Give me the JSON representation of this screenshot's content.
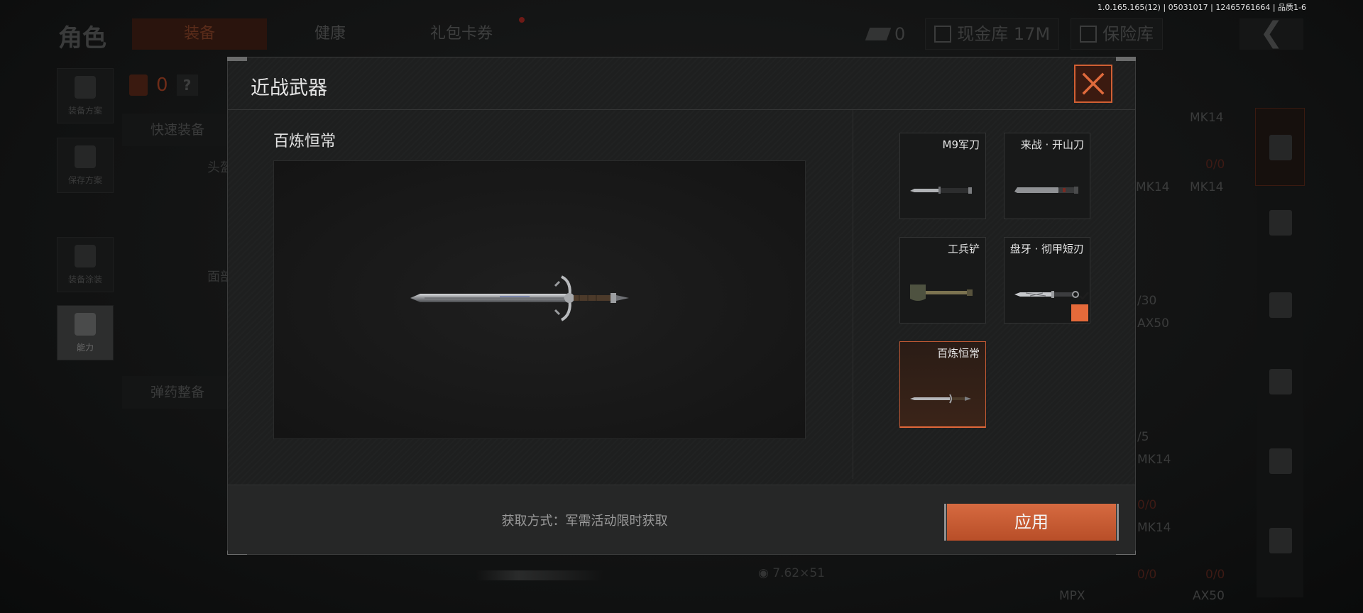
{
  "build_info": "1.0.165.165(12) | 05031017 | 12465761664 | 品质1-6",
  "background": {
    "title": "角色",
    "tabs": [
      "装备",
      "健康",
      "礼包卡券"
    ],
    "currency": "0",
    "cash_vault": "现金库 17M",
    "safe_vault": "保险库",
    "side_buttons": [
      "装备方案",
      "保存方案",
      "装备涂装",
      "能力"
    ],
    "vest_count": "0",
    "help": "?",
    "quick_equip": "快速装备",
    "ammo_prep": "弹药整备",
    "slot_head": "头盔",
    "slot_face": "面部",
    "right_labels": [
      "MK14",
      "0/0",
      "MK14",
      "MK14",
      "/30",
      "AX50",
      "/5",
      "MK14",
      "0/0",
      "MK14",
      "0/0",
      "0/0",
      "MPX",
      "AX50"
    ],
    "ammo_caliber": "7.62×51"
  },
  "modal": {
    "title": "近战武器",
    "selected_weapon_name": "百炼恒常",
    "weapons": [
      {
        "name": "M9军刀",
        "selected": false,
        "checked": false
      },
      {
        "name": "来战 · 开山刀",
        "selected": false,
        "checked": false
      },
      {
        "name": "工兵铲",
        "selected": false,
        "checked": false
      },
      {
        "name": "盘牙 · 彻甲短刃",
        "selected": false,
        "checked": true
      },
      {
        "name": "百炼恒常",
        "selected": true,
        "checked": false
      }
    ],
    "acquire_text": "获取方式：军需活动限时获取",
    "apply_label": "应用"
  },
  "colors": {
    "accent": "#d15f33",
    "apply": "#c4582f",
    "check": "#e56a3a"
  },
  "icons": {
    "close": "close-icon",
    "check": "checkmark-icon"
  }
}
